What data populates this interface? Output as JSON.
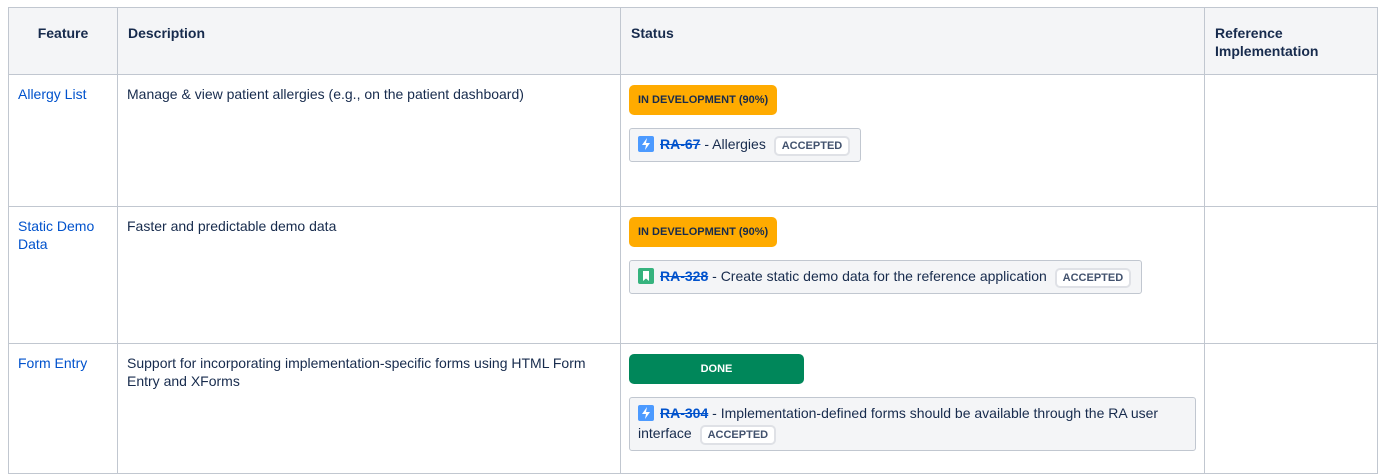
{
  "headers": {
    "feature": "Feature",
    "description": "Description",
    "status": "Status",
    "reference": "Reference Implementation"
  },
  "rows": [
    {
      "feature": "Allergy List",
      "description": "Manage & view patient allergies (e.g., on the patient dashboard)",
      "lozenge": "IN DEVELOPMENT (90%)",
      "issue": {
        "icon": "epic-icon",
        "key": "RA-67",
        "summary": " - Allergies ",
        "status": "ACCEPTED"
      }
    },
    {
      "feature": "Static Demo Data",
      "description": "Faster and predictable demo data",
      "lozenge": "IN DEVELOPMENT (90%)",
      "issue": {
        "icon": "story-icon",
        "key": "RA-328",
        "summary": " - Create static demo data for the reference application ",
        "status": "ACCEPTED"
      }
    },
    {
      "feature": "Form Entry",
      "description": "Support for incorporating implementation-specific forms using HTML Form Entry and XForms",
      "lozenge": "DONE",
      "issue": {
        "icon": "epic-icon",
        "key": "RA-304",
        "summary": " - Implementation-defined forms should be available through the RA user interface ",
        "status": "ACCEPTED"
      }
    }
  ],
  "colors": {
    "link": "#0052cc",
    "in_development": "#ffab00",
    "done": "#00875a",
    "story": "#36b37e",
    "epic": "#4c9aff"
  }
}
